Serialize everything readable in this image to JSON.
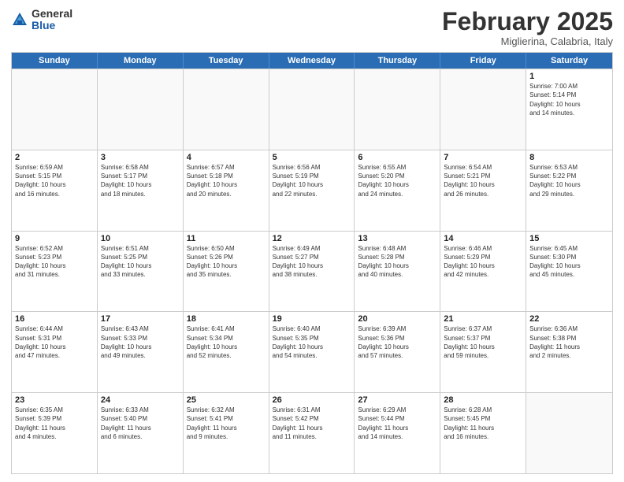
{
  "header": {
    "logo_general": "General",
    "logo_blue": "Blue",
    "title": "February 2025",
    "location": "Miglierina, Calabria, Italy"
  },
  "weekdays": [
    "Sunday",
    "Monday",
    "Tuesday",
    "Wednesday",
    "Thursday",
    "Friday",
    "Saturday"
  ],
  "weeks": [
    [
      {
        "day": "",
        "info": ""
      },
      {
        "day": "",
        "info": ""
      },
      {
        "day": "",
        "info": ""
      },
      {
        "day": "",
        "info": ""
      },
      {
        "day": "",
        "info": ""
      },
      {
        "day": "",
        "info": ""
      },
      {
        "day": "1",
        "info": "Sunrise: 7:00 AM\nSunset: 5:14 PM\nDaylight: 10 hours\nand 14 minutes."
      }
    ],
    [
      {
        "day": "2",
        "info": "Sunrise: 6:59 AM\nSunset: 5:15 PM\nDaylight: 10 hours\nand 16 minutes."
      },
      {
        "day": "3",
        "info": "Sunrise: 6:58 AM\nSunset: 5:17 PM\nDaylight: 10 hours\nand 18 minutes."
      },
      {
        "day": "4",
        "info": "Sunrise: 6:57 AM\nSunset: 5:18 PM\nDaylight: 10 hours\nand 20 minutes."
      },
      {
        "day": "5",
        "info": "Sunrise: 6:56 AM\nSunset: 5:19 PM\nDaylight: 10 hours\nand 22 minutes."
      },
      {
        "day": "6",
        "info": "Sunrise: 6:55 AM\nSunset: 5:20 PM\nDaylight: 10 hours\nand 24 minutes."
      },
      {
        "day": "7",
        "info": "Sunrise: 6:54 AM\nSunset: 5:21 PM\nDaylight: 10 hours\nand 26 minutes."
      },
      {
        "day": "8",
        "info": "Sunrise: 6:53 AM\nSunset: 5:22 PM\nDaylight: 10 hours\nand 29 minutes."
      }
    ],
    [
      {
        "day": "9",
        "info": "Sunrise: 6:52 AM\nSunset: 5:23 PM\nDaylight: 10 hours\nand 31 minutes."
      },
      {
        "day": "10",
        "info": "Sunrise: 6:51 AM\nSunset: 5:25 PM\nDaylight: 10 hours\nand 33 minutes."
      },
      {
        "day": "11",
        "info": "Sunrise: 6:50 AM\nSunset: 5:26 PM\nDaylight: 10 hours\nand 35 minutes."
      },
      {
        "day": "12",
        "info": "Sunrise: 6:49 AM\nSunset: 5:27 PM\nDaylight: 10 hours\nand 38 minutes."
      },
      {
        "day": "13",
        "info": "Sunrise: 6:48 AM\nSunset: 5:28 PM\nDaylight: 10 hours\nand 40 minutes."
      },
      {
        "day": "14",
        "info": "Sunrise: 6:46 AM\nSunset: 5:29 PM\nDaylight: 10 hours\nand 42 minutes."
      },
      {
        "day": "15",
        "info": "Sunrise: 6:45 AM\nSunset: 5:30 PM\nDaylight: 10 hours\nand 45 minutes."
      }
    ],
    [
      {
        "day": "16",
        "info": "Sunrise: 6:44 AM\nSunset: 5:31 PM\nDaylight: 10 hours\nand 47 minutes."
      },
      {
        "day": "17",
        "info": "Sunrise: 6:43 AM\nSunset: 5:33 PM\nDaylight: 10 hours\nand 49 minutes."
      },
      {
        "day": "18",
        "info": "Sunrise: 6:41 AM\nSunset: 5:34 PM\nDaylight: 10 hours\nand 52 minutes."
      },
      {
        "day": "19",
        "info": "Sunrise: 6:40 AM\nSunset: 5:35 PM\nDaylight: 10 hours\nand 54 minutes."
      },
      {
        "day": "20",
        "info": "Sunrise: 6:39 AM\nSunset: 5:36 PM\nDaylight: 10 hours\nand 57 minutes."
      },
      {
        "day": "21",
        "info": "Sunrise: 6:37 AM\nSunset: 5:37 PM\nDaylight: 10 hours\nand 59 minutes."
      },
      {
        "day": "22",
        "info": "Sunrise: 6:36 AM\nSunset: 5:38 PM\nDaylight: 11 hours\nand 2 minutes."
      }
    ],
    [
      {
        "day": "23",
        "info": "Sunrise: 6:35 AM\nSunset: 5:39 PM\nDaylight: 11 hours\nand 4 minutes."
      },
      {
        "day": "24",
        "info": "Sunrise: 6:33 AM\nSunset: 5:40 PM\nDaylight: 11 hours\nand 6 minutes."
      },
      {
        "day": "25",
        "info": "Sunrise: 6:32 AM\nSunset: 5:41 PM\nDaylight: 11 hours\nand 9 minutes."
      },
      {
        "day": "26",
        "info": "Sunrise: 6:31 AM\nSunset: 5:42 PM\nDaylight: 11 hours\nand 11 minutes."
      },
      {
        "day": "27",
        "info": "Sunrise: 6:29 AM\nSunset: 5:44 PM\nDaylight: 11 hours\nand 14 minutes."
      },
      {
        "day": "28",
        "info": "Sunrise: 6:28 AM\nSunset: 5:45 PM\nDaylight: 11 hours\nand 16 minutes."
      },
      {
        "day": "",
        "info": ""
      }
    ]
  ]
}
